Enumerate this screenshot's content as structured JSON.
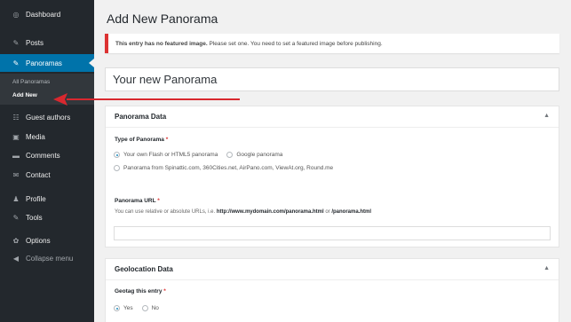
{
  "sidebar": {
    "items": [
      {
        "label": "Dashboard",
        "icon": "dashboard-icon",
        "glyph": "◎"
      },
      {
        "label": "Posts",
        "icon": "pin-icon",
        "glyph": "✎"
      },
      {
        "label": "Panoramas",
        "icon": "pin-icon",
        "glyph": "✎"
      },
      {
        "label": "Guest authors",
        "icon": "users-icon",
        "glyph": "☷"
      },
      {
        "label": "Media",
        "icon": "media-icon",
        "glyph": "▣"
      },
      {
        "label": "Comments",
        "icon": "comments-icon",
        "glyph": "▬"
      },
      {
        "label": "Contact",
        "icon": "mail-icon",
        "glyph": "✉"
      },
      {
        "label": "Profile",
        "icon": "user-icon",
        "glyph": "♟"
      },
      {
        "label": "Tools",
        "icon": "wrench-icon",
        "glyph": "✎"
      },
      {
        "label": "Options",
        "icon": "gear-icon",
        "glyph": "✿"
      },
      {
        "label": "Collapse menu",
        "icon": "collapse-icon",
        "glyph": "◀"
      }
    ],
    "submenu": [
      {
        "label": "All Panoramas"
      },
      {
        "label": "Add New"
      }
    ]
  },
  "page": {
    "title": "Add New Panorama",
    "notice_bold": "This entry has no featured image.",
    "notice_text": "Please set one. You need to set a featured image before publishing.",
    "title_value": "Your new Panorama"
  },
  "panorama_box": {
    "heading": "Panorama Data",
    "toggle": "▲",
    "type_label": "Type of Panorama",
    "required_mark": "*",
    "options": [
      "Your own Flash or HTML5 panorama",
      "Google panorama",
      "Panorama from Spinattic.com, 360Cities.net, AirPano.com, ViewAt.org, Round.me"
    ],
    "url_label": "Panorama URL",
    "url_help_prefix": "You can use relative or absolute URLs, i.e.",
    "url_example_1": "http://www.mydomain.com/panorama.html",
    "url_help_or": "or",
    "url_example_2": "/panorama.html",
    "url_value": ""
  },
  "geo_box": {
    "heading": "Geolocation Data",
    "toggle": "▲",
    "geotag_label": "Geotag this entry",
    "required_mark": "*",
    "options": [
      "Yes",
      "No"
    ]
  },
  "colors": {
    "sidebar_bg": "#23282d",
    "active_bg": "#0073aa",
    "notice_border": "#dc3232",
    "arrow": "#d9282f"
  }
}
